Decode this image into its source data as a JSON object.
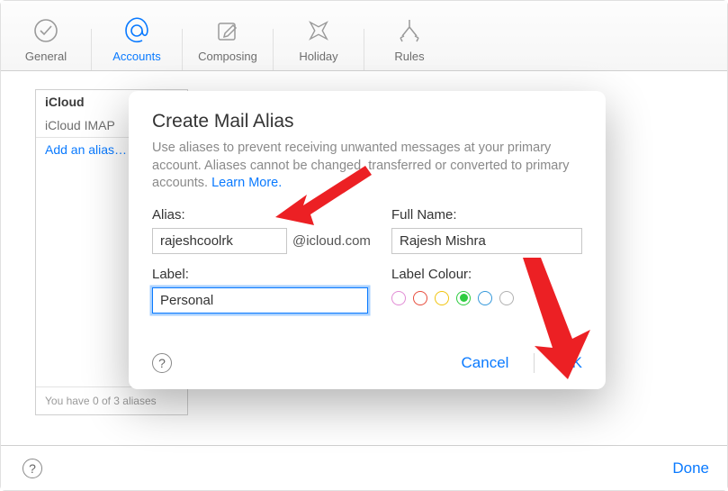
{
  "toolbar": {
    "items": [
      {
        "label": "General"
      },
      {
        "label": "Accounts"
      },
      {
        "label": "Composing"
      },
      {
        "label": "Holiday"
      },
      {
        "label": "Rules"
      }
    ]
  },
  "sidebar": {
    "account_name": "iCloud",
    "account_sub": "iCloud IMAP",
    "add_alias_label": "Add an alias…",
    "footer": "You have 0 of 3 aliases"
  },
  "modal": {
    "title": "Create Mail Alias",
    "description": "Use aliases to prevent receiving unwanted messages at your primary account. Aliases cannot be changed, transferred or converted to primary accounts. ",
    "learn_more": "Learn More.",
    "alias_label": "Alias:",
    "alias_value": "rajeshcoolrk",
    "alias_suffix": "@icloud.com",
    "fullname_label": "Full Name:",
    "fullname_value": "Rajesh Mishra",
    "label_label": "Label:",
    "label_value": "Personal",
    "colour_label": "Label Colour:",
    "colours": [
      {
        "hex": "#e18bd4"
      },
      {
        "hex": "#e74c3c"
      },
      {
        "hex": "#f1c40f"
      },
      {
        "hex": "#2ecc40",
        "selected": true
      },
      {
        "hex": "#3498db"
      },
      {
        "hex": "#b0b0b0"
      }
    ],
    "cancel": "Cancel",
    "ok": "OK"
  },
  "bottom": {
    "done": "Done"
  }
}
